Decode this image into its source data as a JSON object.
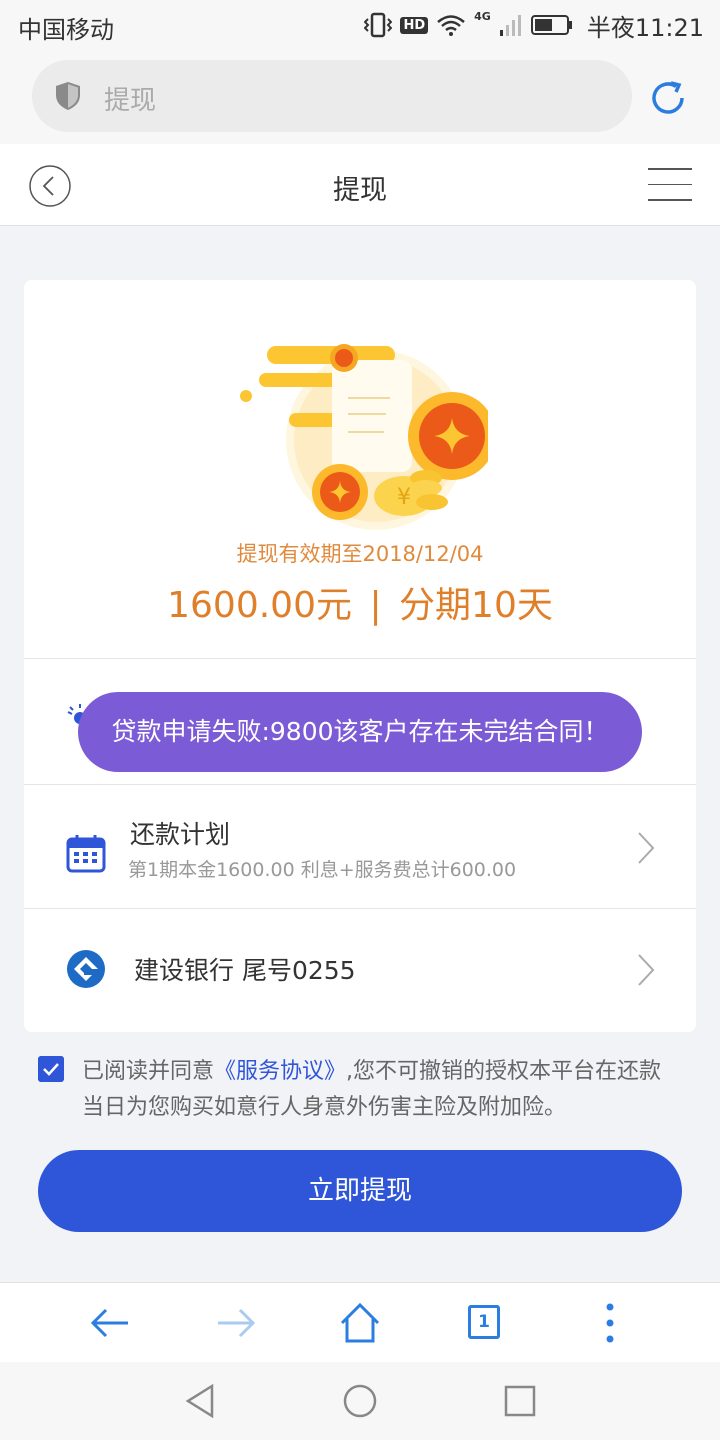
{
  "status_bar": {
    "carrier": "中国移动",
    "hd_badge": "HD",
    "network": "4G",
    "time": "半夜11:21",
    "battery_fraction": 0.55
  },
  "browser": {
    "url_text": "提现"
  },
  "header": {
    "title": "提现"
  },
  "card": {
    "valid_text": "提现有效期至2018/12/04",
    "amount": "1600.00元",
    "separator": "|",
    "installment": "分期10天"
  },
  "toast": {
    "message": "贷款申请失败:9800该客户存在未完结合同！"
  },
  "repayment_plan": {
    "title": "还款计划",
    "subtitle": "第1期本金1600.00 利息+服务费总计600.00"
  },
  "bank": {
    "label": "建设银行 尾号0255"
  },
  "agreement": {
    "checked": true,
    "prefix": "已阅读并同意",
    "link": "《服务协议》",
    "suffix": ",您不可撤销的授权本平台在还款当日为您购买如意行人身意外伤害主险及附加险。"
  },
  "submit": {
    "label": "立即提现"
  },
  "browser_nav": {
    "tab_count": "1"
  },
  "colors": {
    "primary": "#2f56d8",
    "toast": "#7b5bd6",
    "accent_orange": "#e07f2a",
    "nav_blue": "#2b7de0"
  }
}
